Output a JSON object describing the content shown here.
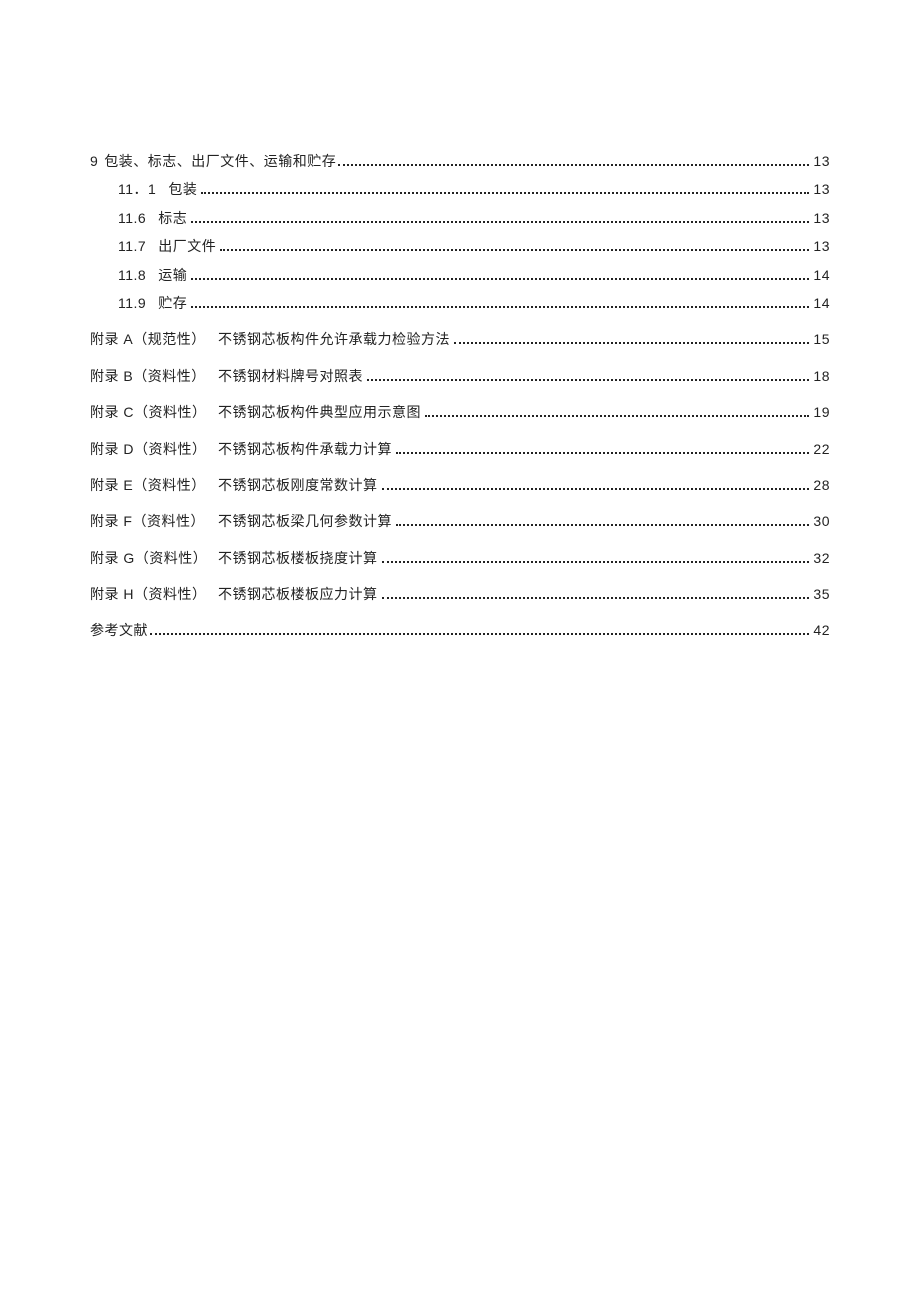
{
  "toc": {
    "section9": {
      "num": "9",
      "title": "包装、标志、出厂文件、运输和贮存",
      "page": "13"
    },
    "sub": [
      {
        "num": "11．1",
        "title": "包装",
        "page": "13"
      },
      {
        "num": "11.6",
        "title": "标志",
        "page": "13"
      },
      {
        "num": "11.7",
        "title": "出厂文件",
        "page": "13"
      },
      {
        "num": "11.8",
        "title": "运输",
        "page": "14"
      },
      {
        "num": "11.9",
        "title": "贮存",
        "page": "14"
      }
    ],
    "appendix": [
      {
        "key": "附录 A（规范性）",
        "title": "不锈钢芯板构件允许承载力检验方法",
        "page": "15"
      },
      {
        "key": "附录 B（资料性）",
        "title": "不锈钢材料牌号对照表",
        "page": "18"
      },
      {
        "key": "附录 C（资料性）",
        "title": "不锈钢芯板构件典型应用示意图",
        "page": "19"
      },
      {
        "key": "附录 D（资料性）",
        "title": "不锈钢芯板构件承载力计算",
        "page": "22"
      },
      {
        "key": "附录 E（资料性）",
        "title": "不锈钢芯板刚度常数计算",
        "page": "28"
      },
      {
        "key": "附录 F（资料性）",
        "title": "不锈钢芯板梁几何参数计算",
        "page": "30"
      },
      {
        "key": "附录 G（资料性）",
        "title": "不锈钢芯板楼板挠度计算",
        "page": "32"
      },
      {
        "key": "附录 H（资料性）",
        "title": "不锈钢芯板楼板应力计算",
        "page": "35"
      }
    ],
    "refs": {
      "title": "参考文献",
      "page": "42"
    }
  }
}
